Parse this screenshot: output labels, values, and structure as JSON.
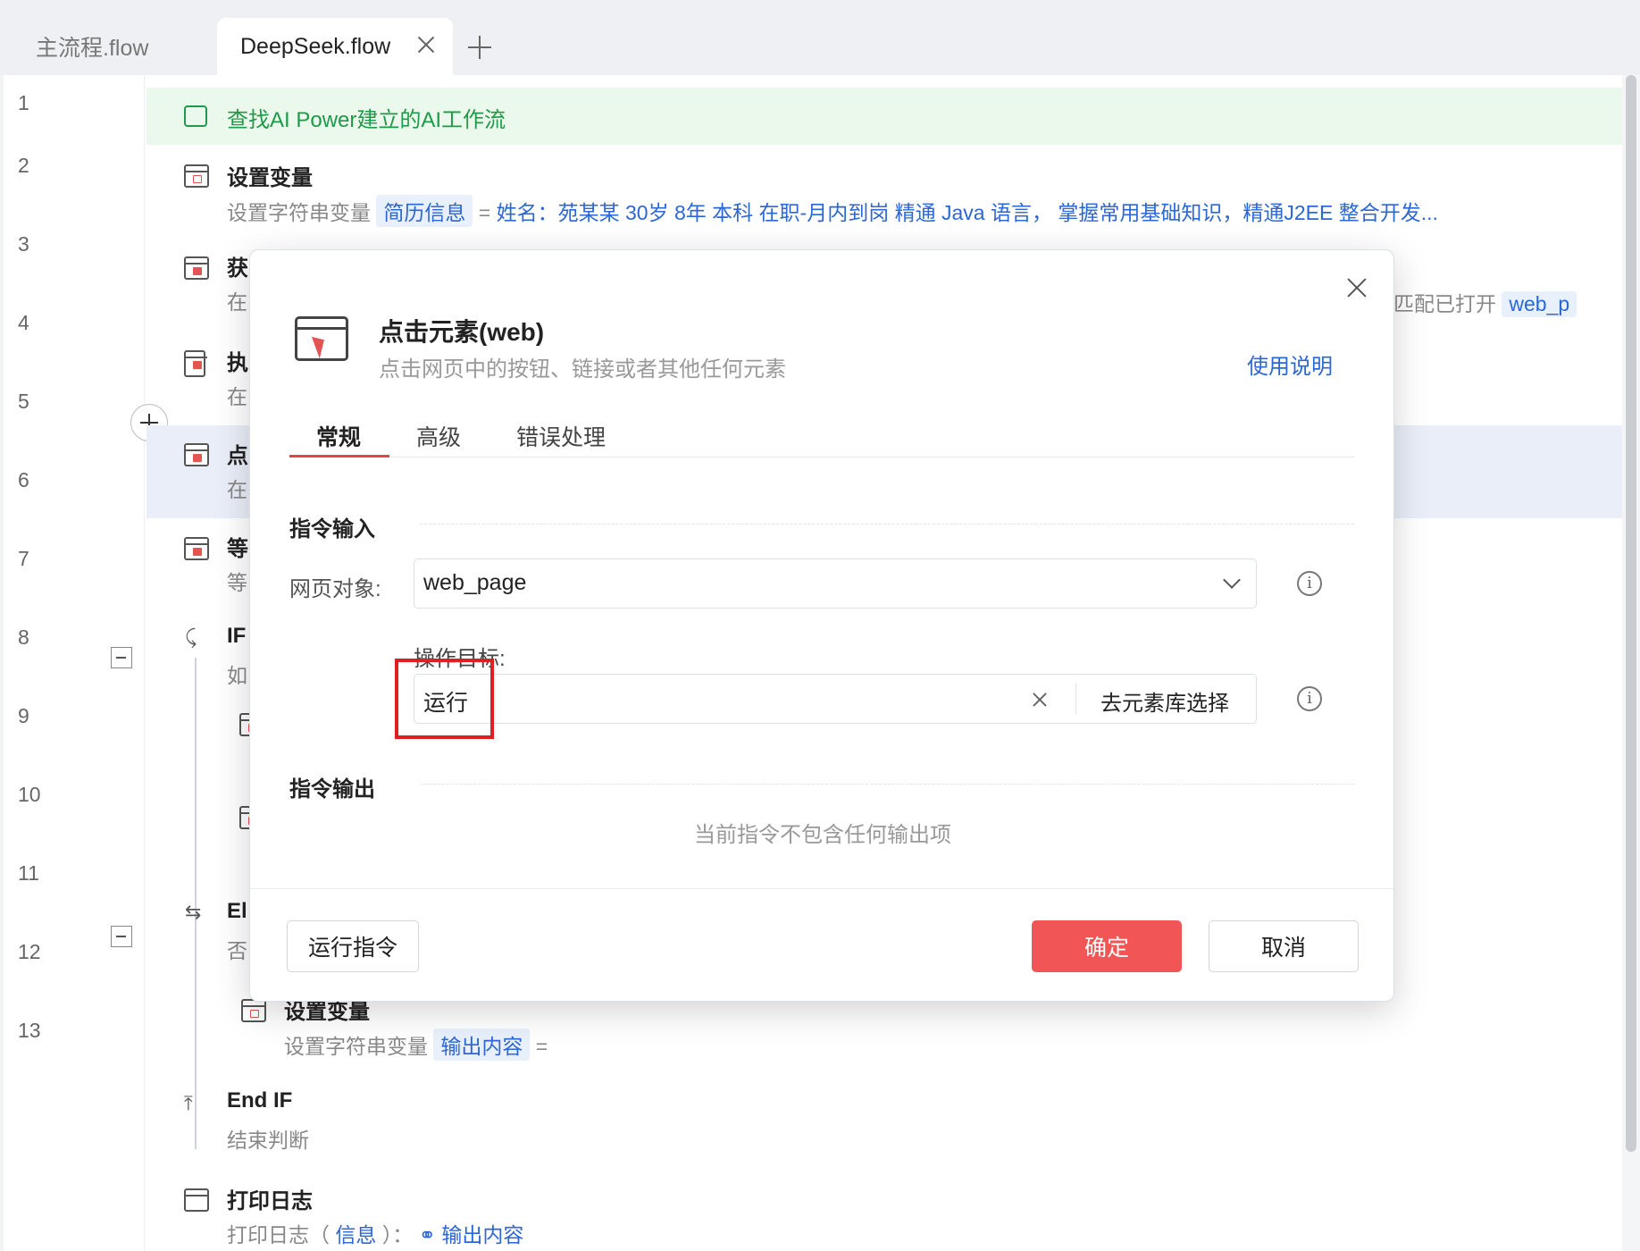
{
  "tabs": [
    {
      "label": "主流程.flow",
      "active": false
    },
    {
      "label": "DeepSeek.flow",
      "active": true
    }
  ],
  "line_numbers": [
    "1",
    "2",
    "3",
    "4",
    "5",
    "6",
    "7",
    "8",
    "9",
    "10",
    "11",
    "12",
    "13"
  ],
  "flow": {
    "l1": {
      "text": "查找AI Power建立的AI工作流"
    },
    "l2": {
      "title": "设置变量",
      "sub_prefix": "设置字符串变量",
      "var": "简历信息",
      "eq": "=",
      "value": "姓名：苑某某 30岁 8年   本科   在职-月内到岗 精通 Java 语言，  掌握常用基础知识，精通J2EE 整合开发..."
    },
    "l3": {
      "title": "获",
      "sub": "在",
      "right_text": "匹配已打开",
      "right_var": "web_p"
    },
    "l4": {
      "title": "执",
      "sub": "在"
    },
    "l5": {
      "title": "点",
      "sub": "在"
    },
    "l6": {
      "title": "等",
      "sub": "等"
    },
    "l7": {
      "title": "IF",
      "sub": "如"
    },
    "l10": {
      "title": "El",
      "sub": "否"
    },
    "l11": {
      "title": "设置变量",
      "sub_prefix": "设置字符串变量",
      "var": "输出内容",
      "eq": "="
    },
    "l12": {
      "title": "End IF",
      "sub": "结束判断"
    },
    "l13": {
      "title": "打印日志",
      "sub_prefix": "打印日志（",
      "level": "信息",
      "sub_mid": "）：",
      "var": "输出内容"
    }
  },
  "dialog": {
    "title": "点击元素(web)",
    "description": "点击网页中的按钮、链接或者其他任何元素",
    "help_link": "使用说明",
    "tabs": [
      "常规",
      "高级",
      "错误处理"
    ],
    "active_tab": "常规",
    "input_section": "指令输入",
    "web_object_label": "网页对象:",
    "web_object_value": "web_page",
    "target_label": "操作目标:",
    "target_value": "运行",
    "pick_from_library": "去元素库选择",
    "output_section": "指令输出",
    "no_output": "当前指令不包含任何输出项",
    "run_button": "运行指令",
    "confirm_button": "确定",
    "cancel_button": "取消"
  },
  "colors": {
    "accent": "#2b67d6",
    "primary_button": "#f25555",
    "note_green": "#1f9a4a",
    "highlight_box": "#e02020"
  }
}
